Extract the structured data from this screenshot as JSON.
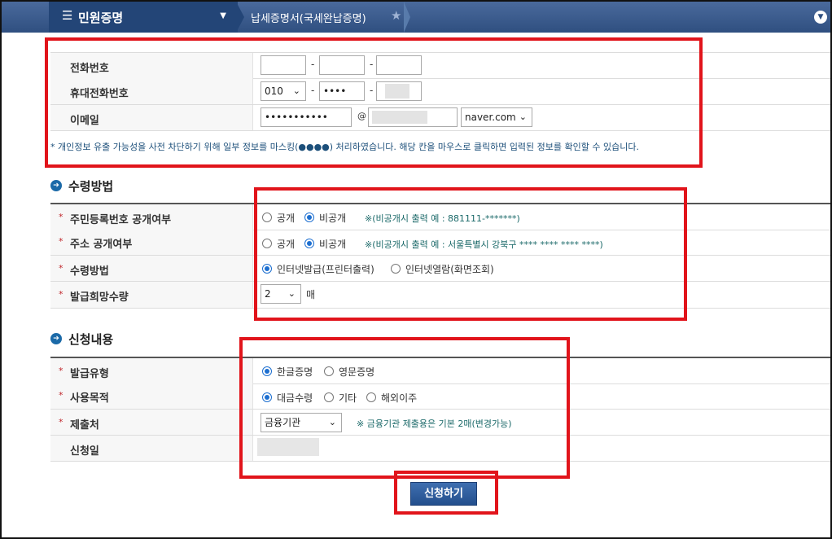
{
  "header": {
    "menu_label": "민원증명",
    "breadcrumb": "납세증명서(국세완납증명)"
  },
  "contact": {
    "phone_label": "전화번호",
    "mobile_label": "휴대전화번호",
    "mobile_prefix": "010",
    "mobile_mid": "••••",
    "email_label": "이메일",
    "email_local": "•••••••••••",
    "at": "@",
    "email_domain_select": "naver.com",
    "dash": "-",
    "disclaimer": "* 개인정보 유출 가능성을 사전 차단하기 위해 일부 정보를 마스킹(●●●●) 처리하였습니다. 해당 칸을 마우스로 클릭하면 입력된 정보를 확인할 수 있습니다."
  },
  "receive": {
    "section_title": "수령방법",
    "req_mark": "*",
    "rrn_label": "주민등록번호 공개여부",
    "addr_label": "주소 공개여부",
    "method_label": "수령방법",
    "qty_label": "발급희망수량",
    "public": "공개",
    "private": "비공개",
    "rrn_note": "※(비공개시 출력 예 : 881111-*******)",
    "addr_note": "※(비공개시 출력 예 : 서울특별시 강북구 **** **** **** ****)",
    "method_internet_print": "인터넷발급(프린터출력)",
    "method_internet_view": "인터넷열람(화면조회)",
    "qty_value": "2",
    "qty_unit": "매"
  },
  "apply": {
    "section_title": "신청내용",
    "issue_type_label": "발급유형",
    "korean": "한글증명",
    "english": "영문증명",
    "purpose_label": "사용목적",
    "purpose_loan": "대금수령",
    "purpose_other": "기타",
    "purpose_emigration": "해외이주",
    "submit_to_label": "제출처",
    "submit_to_value": "금융기관",
    "submit_note": "※ 금융기관 제출용은 기본 2매(변경가능)",
    "date_label": "신청일"
  },
  "submit_button": "신청하기",
  "colors": {
    "highlight": "#e1141b",
    "header": "#2f4f80",
    "radio_selected": "#1d6fd0"
  },
  "icons": [
    "hamburger-icon",
    "caret-down-icon",
    "star-icon",
    "expand-chevron-icon",
    "section-arrow-icon"
  ]
}
